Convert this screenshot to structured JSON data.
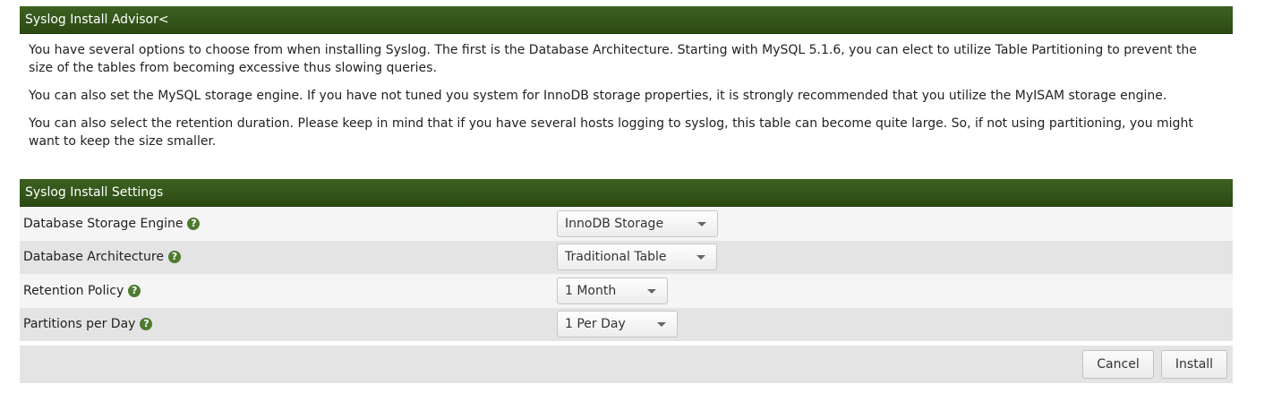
{
  "advisor": {
    "title": "Syslog Install Advisor<",
    "paragraphs": [
      "You have several options to choose from when installing Syslog. The first is the Database Architecture. Starting with MySQL 5.1.6, you can elect to utilize Table Partitioning to prevent the size of the tables from becoming excessive thus slowing queries.",
      "You can also set the MySQL storage engine. If you have not tuned you system for InnoDB storage properties, it is strongly recommended that you utilize the MyISAM storage engine.",
      "You can also select the retention duration. Please keep in mind that if you have several hosts logging to syslog, this table can become quite large. So, if not using partitioning, you might want to keep the size smaller."
    ]
  },
  "settings": {
    "title": "Syslog Install Settings",
    "rows": [
      {
        "label": "Database Storage Engine",
        "value": "InnoDB Storage"
      },
      {
        "label": "Database Architecture",
        "value": "Traditional Table"
      },
      {
        "label": "Retention Policy",
        "value": "1 Month"
      },
      {
        "label": "Partitions per Day",
        "value": "1 Per Day"
      }
    ],
    "help_glyph": "?"
  },
  "buttons": {
    "cancel": "Cancel",
    "install": "Install"
  },
  "colors": {
    "header_green": "#2f5018",
    "help_icon_green": "#4e7a31"
  },
  "icons": {
    "help": "question-circle-icon",
    "dropdown": "caret-down-icon"
  }
}
